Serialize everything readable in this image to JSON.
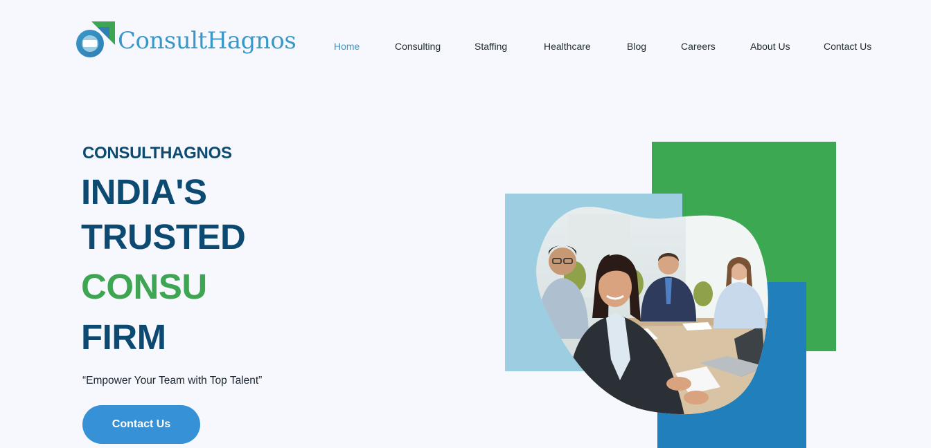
{
  "brand": {
    "name": "ConsultHagnos",
    "colors": {
      "primary": "#3a98c8",
      "navy": "#0d4a72",
      "green": "#3ea652",
      "light_blue": "#9ccde1",
      "blue": "#2180bb",
      "button": "#3691d6"
    }
  },
  "nav": {
    "items": [
      {
        "label": "Home",
        "active": true
      },
      {
        "label": "Consulting",
        "active": false
      },
      {
        "label": "Staffing",
        "active": false
      },
      {
        "label": "Healthcare",
        "active": false
      },
      {
        "label": "Blog",
        "active": false
      },
      {
        "label": "Careers",
        "active": false
      },
      {
        "label": "About Us",
        "active": false
      },
      {
        "label": "Contact Us",
        "active": false
      }
    ]
  },
  "hero": {
    "eyebrow": "CONSULTHAGNOS",
    "line1": "INDIA'S",
    "line2": "TRUSTED",
    "line3": "CONSU",
    "line4": "FIRM",
    "tagline": "“Empower Your Team with Top Talent”",
    "cta_label": "Contact Us",
    "image_icon": "team-meeting-photo"
  }
}
